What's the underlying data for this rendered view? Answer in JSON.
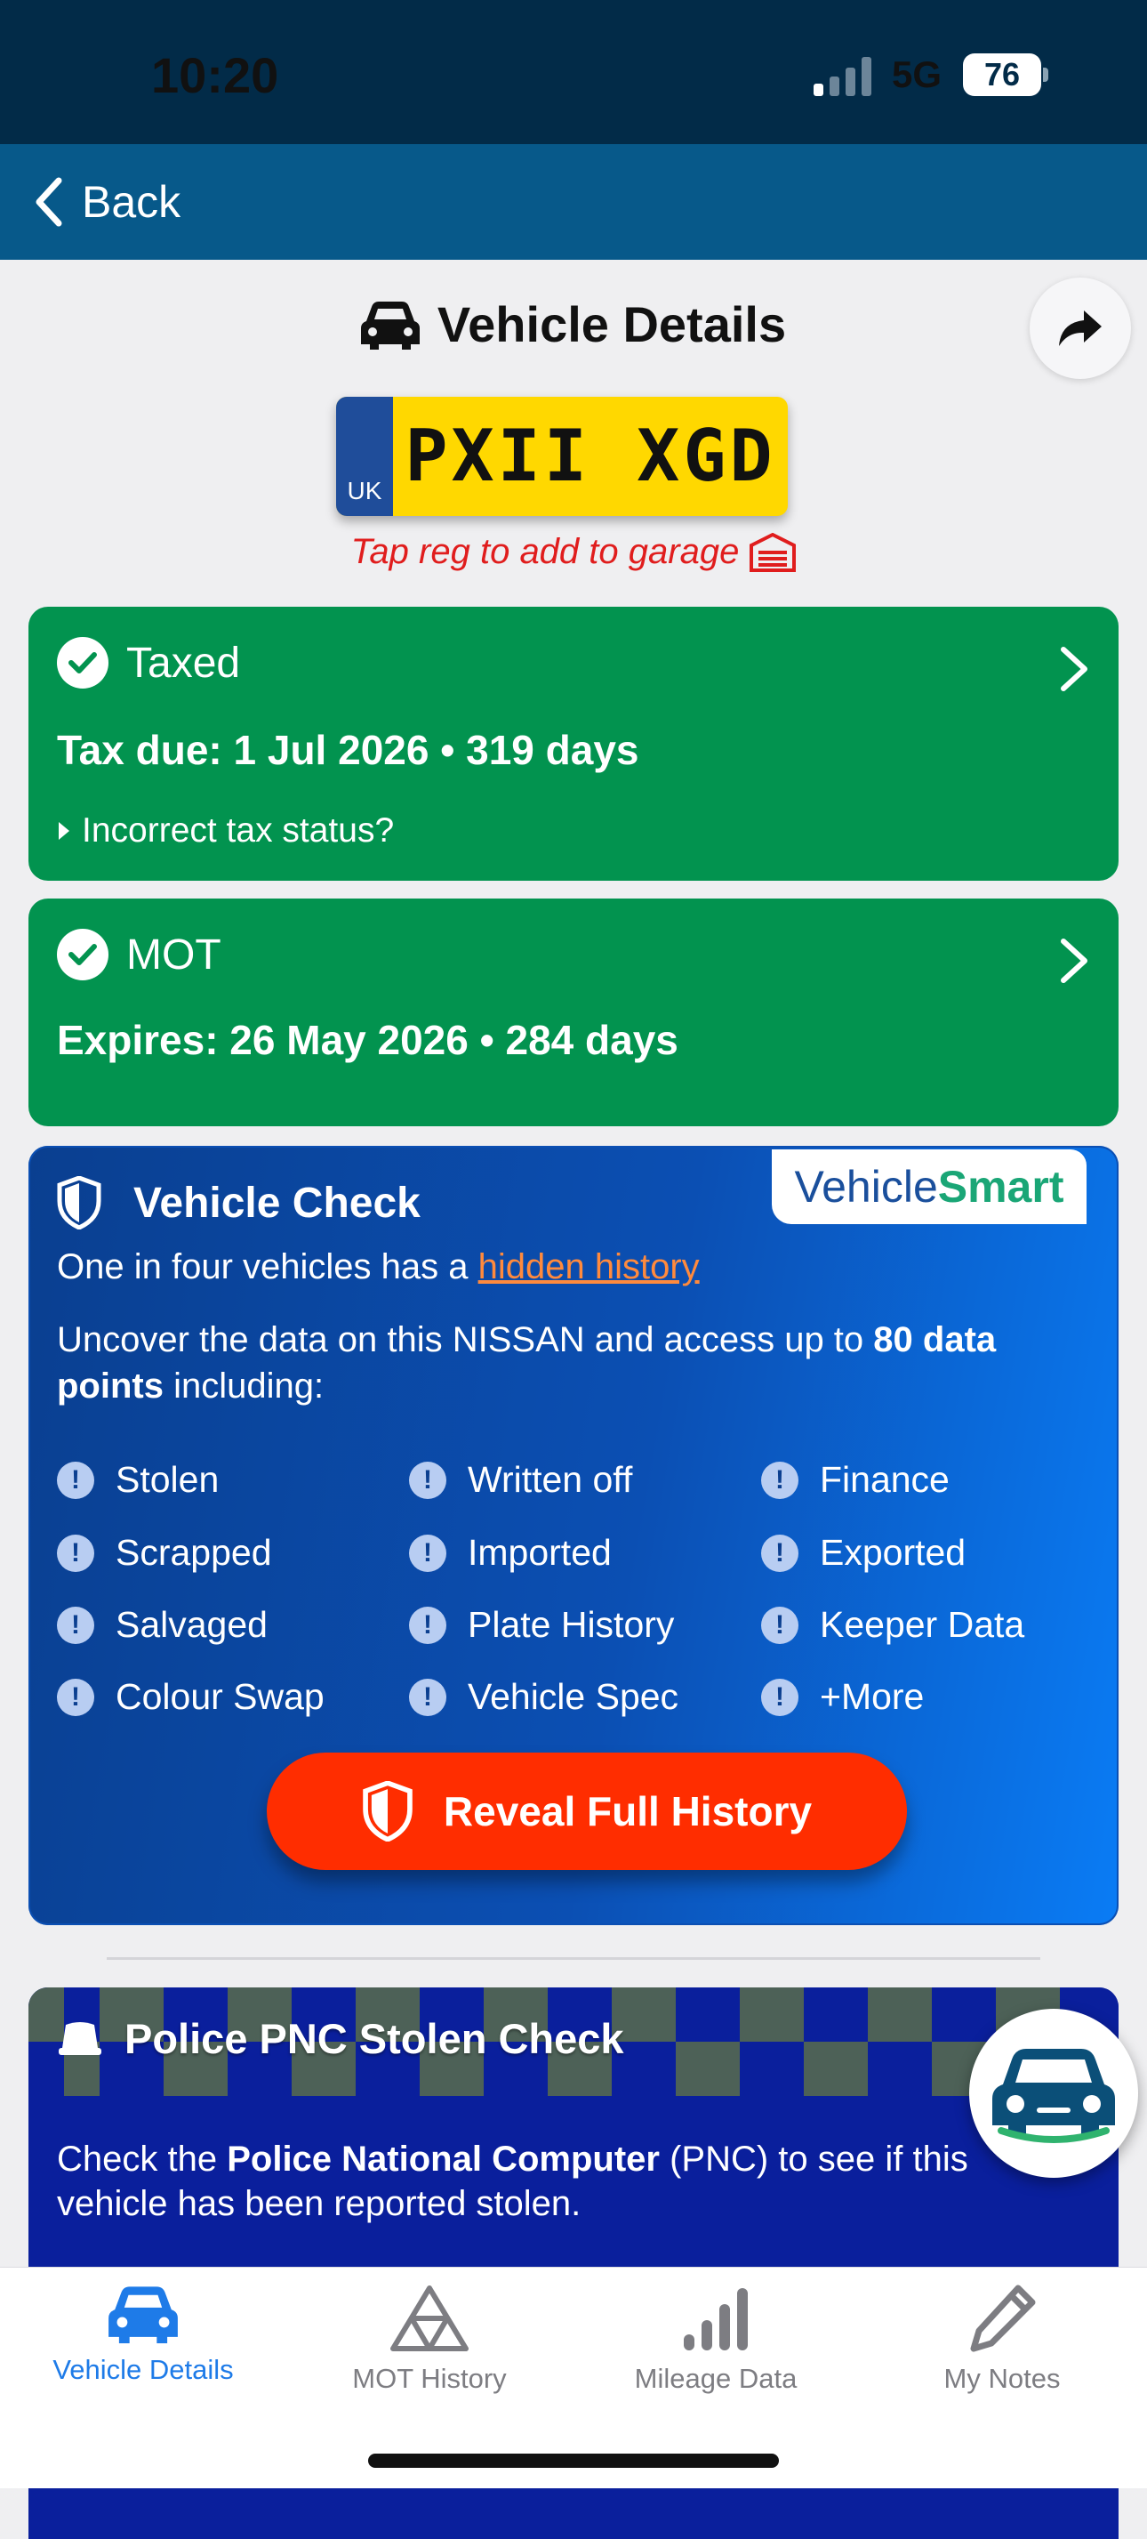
{
  "status_bar": {
    "time": "10:20",
    "network": "5G",
    "battery": "76"
  },
  "nav": {
    "back_label": "Back"
  },
  "header": {
    "title": "Vehicle Details"
  },
  "plate": {
    "country": "UK",
    "registration": "PXII XGD",
    "hint": "Tap reg to add to garage"
  },
  "tax": {
    "status": "Taxed",
    "due_line": "Tax due: 1 Jul 2026 • 319 days",
    "incorrect_link": "Incorrect tax status?"
  },
  "mot": {
    "status": "MOT",
    "expires_line": "Expires: 26 May 2026 • 284 days"
  },
  "vehicle_check": {
    "title": "Vehicle Check",
    "logo_part1": "Vehicle",
    "logo_part2": "Smart",
    "intro_prefix": "One in four vehicles has a ",
    "intro_link": "hidden history",
    "detail_prefix": "Uncover the data on this NISSAN and access up to ",
    "detail_bold": "80 data points",
    "detail_suffix": " including:",
    "features": [
      [
        "Stolen",
        "Written off",
        "Finance"
      ],
      [
        "Scrapped",
        "Imported",
        "Exported"
      ],
      [
        "Salvaged",
        "Plate History",
        "Keeper Data"
      ],
      [
        "Colour Swap",
        "Vehicle Spec",
        "+More"
      ]
    ],
    "button_label": "Reveal Full History"
  },
  "police": {
    "title": "Police PNC Stolen Check",
    "text_prefix": "Check the ",
    "text_bold": "Police National Computer",
    "text_suffix": " (PNC) to see if this vehicle has been reported stolen."
  },
  "tabs": [
    {
      "label": "Vehicle Details",
      "icon": "car-icon",
      "active": true
    },
    {
      "label": "MOT History",
      "icon": "mot-triangle-icon",
      "active": false
    },
    {
      "label": "Mileage Data",
      "icon": "bar-chart-icon",
      "active": false
    },
    {
      "label": "My Notes",
      "icon": "pencil-icon",
      "active": false
    }
  ],
  "colors": {
    "status_bar": "#022b48",
    "nav": "#07598a",
    "green": "#02934f",
    "reveal": "#ff2d00",
    "police": "#0a1f9c",
    "active_tab": "#1e7be8"
  }
}
